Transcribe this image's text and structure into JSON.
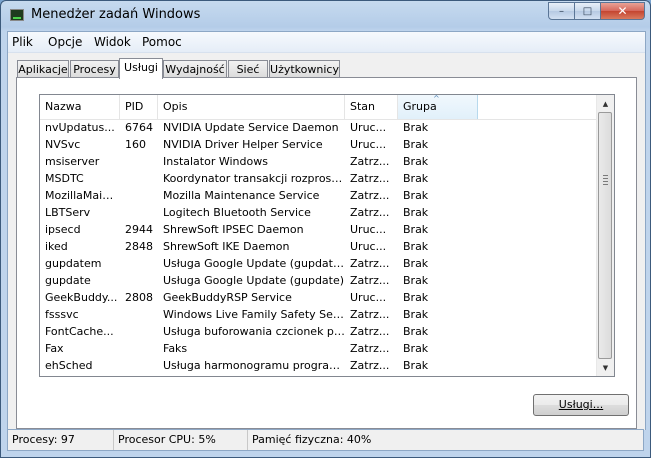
{
  "window": {
    "title": "Menedżer zadań Windows"
  },
  "caption_buttons": {
    "minimize": "–",
    "maximize": "□",
    "close": "✕"
  },
  "menu": [
    "Plik",
    "Opcje",
    "Widok",
    "Pomoc"
  ],
  "tabs": [
    "Aplikacje",
    "Procesy",
    "Usługi",
    "Wydajność",
    "Sieć",
    "Użytkownicy"
  ],
  "active_tab": "Usługi",
  "columns": [
    "Nazwa",
    "PID",
    "Opis",
    "Stan",
    "Grupa"
  ],
  "sort": {
    "column": "Grupa",
    "direction": "ascending",
    "arrow": "^"
  },
  "rows": [
    [
      "nvUpdatus...",
      "6764",
      "NVIDIA Update Service Daemon",
      "Uruc...",
      "Brak"
    ],
    [
      "NVSvc",
      "160",
      "NVIDIA Driver Helper Service",
      "Uruc...",
      "Brak"
    ],
    [
      "msiserver",
      "",
      "Instalator Windows",
      "Zatrz...",
      "Brak"
    ],
    [
      "MSDTC",
      "",
      "Koordynator transakcji rozproszo...",
      "Zatrz...",
      "Brak"
    ],
    [
      "MozillaMaint...",
      "",
      "Mozilla Maintenance Service",
      "Zatrz...",
      "Brak"
    ],
    [
      "LBTServ",
      "",
      "Logitech Bluetooth Service",
      "Zatrz...",
      "Brak"
    ],
    [
      "ipsecd",
      "2944",
      "ShrewSoft IPSEC Daemon",
      "Uruc...",
      "Brak"
    ],
    [
      "iked",
      "2848",
      "ShrewSoft IKE Daemon",
      "Uruc...",
      "Brak"
    ],
    [
      "gupdatem",
      "",
      "Usługa Google Update (gupdatem)",
      "Zatrz...",
      "Brak"
    ],
    [
      "gupdate",
      "",
      "Usługa Google Update (gupdate)",
      "Zatrz...",
      "Brak"
    ],
    [
      "GeekBuddy...",
      "2808",
      "GeekBuddyRSP Service",
      "Uruc...",
      "Brak"
    ],
    [
      "fsssvc",
      "",
      "Windows Live Family Safety Service",
      "Zatrz...",
      "Brak"
    ],
    [
      "FontCache...",
      "",
      "Usługa buforowania czcionek plat...",
      "Zatrz...",
      "Brak"
    ],
    [
      "Fax",
      "",
      "Faks",
      "Zatrz...",
      "Brak"
    ],
    [
      "ehSched",
      "",
      "Usługa harmonogramu programu ...",
      "Zatrz...",
      "Brak"
    ]
  ],
  "services_button": "Usługi...",
  "status": {
    "processes": "Procesy: 97",
    "cpu": "Procesor CPU: 5%",
    "memory": "Pamięć fizyczna: 40%"
  }
}
